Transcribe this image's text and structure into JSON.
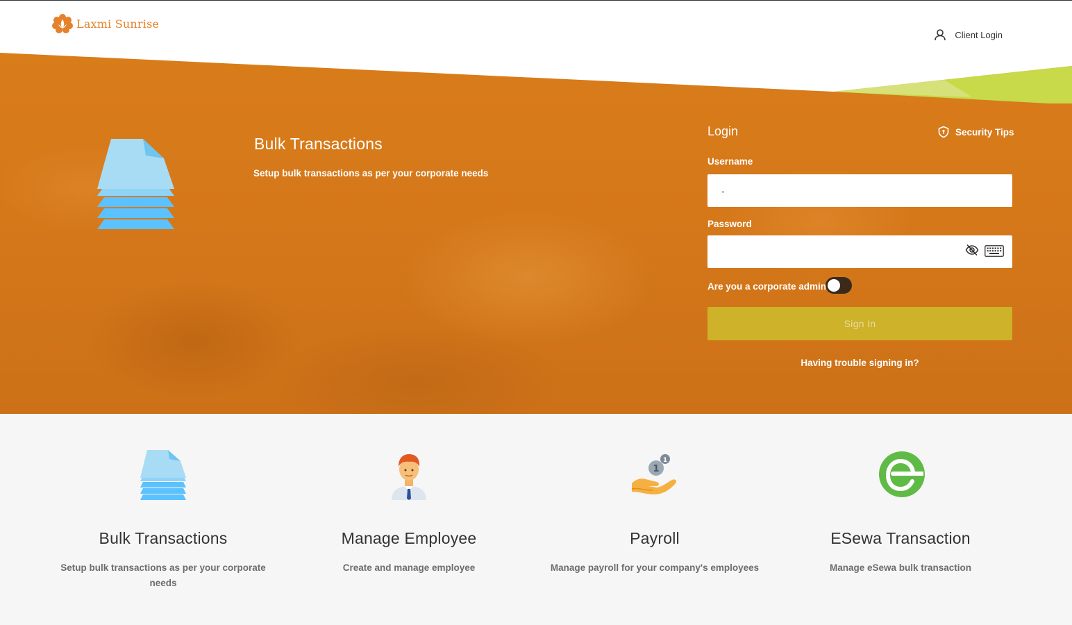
{
  "header": {
    "brand_name": "Laxmi Sunrise",
    "client_login_label": "Client Login"
  },
  "hero": {
    "title": "Bulk Transactions",
    "subtitle": "Setup bulk transactions as per your corporate needs"
  },
  "login": {
    "title": "Login",
    "security_tips_label": "Security Tips",
    "username_label": "Username",
    "username_value": "-",
    "password_label": "Password",
    "password_value": "",
    "corporate_admin_label": "Are you a corporate admin?",
    "corporate_admin_on": false,
    "sign_in_label": "Sign In",
    "trouble_label": "Having trouble signing in?"
  },
  "features": [
    {
      "title": "Bulk Transactions",
      "description": "Setup bulk transactions as per your corporate needs",
      "icon": "bulk-document-icon"
    },
    {
      "title": "Manage Employee",
      "description": "Create and manage employee",
      "icon": "employee-icon"
    },
    {
      "title": "Payroll",
      "description": "Manage payroll for your company's employees",
      "icon": "payroll-hand-coin-icon"
    },
    {
      "title": "ESewa Transaction",
      "description": "Manage eSewa bulk transaction",
      "icon": "esewa-logo-icon"
    }
  ],
  "colors": {
    "brand_orange": "#e5812a",
    "hero_orange": "#d97c1a",
    "sign_in_button": "#cdb22a",
    "accent_green": "#c8d94a",
    "esewa_green": "#60bb46"
  }
}
